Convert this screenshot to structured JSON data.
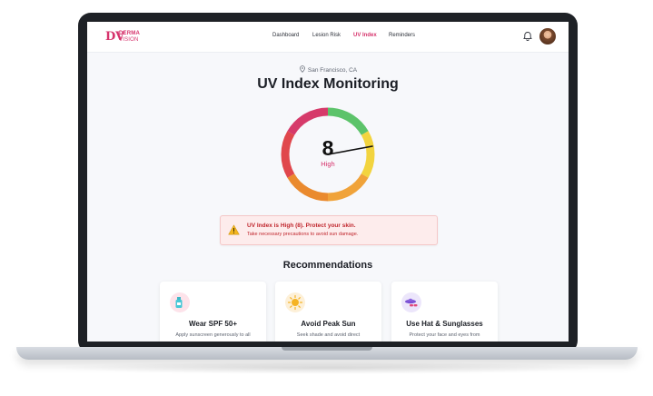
{
  "brand": {
    "line1": "DERMA",
    "line2": "VISION",
    "mark": "DV",
    "color": "#d6336c"
  },
  "nav": {
    "items": [
      {
        "label": "Dashboard",
        "active": false
      },
      {
        "label": "Lesion Risk",
        "active": false
      },
      {
        "label": "UV Index",
        "active": true
      },
      {
        "label": "Reminders",
        "active": false
      }
    ],
    "bell_icon": "bell-icon",
    "avatar": "user-avatar"
  },
  "location": {
    "icon": "map-pin-icon",
    "label": "San Francisco, CA"
  },
  "page_title": "UV Index Monitoring",
  "gauge": {
    "value": "8",
    "level": "High",
    "level_color": "#d6336c",
    "segment_colors": [
      "#5cc36a",
      "#f2d43f",
      "#f0a33a",
      "#ea8a2e",
      "#e0474c",
      "#d63a6a"
    ]
  },
  "alert": {
    "icon": "warning-icon",
    "title": "UV Index is High (8). Protect your skin.",
    "subtitle": "Take necessary precautions to avoid sun damage."
  },
  "recommendations": {
    "heading": "Recommendations",
    "cards": [
      {
        "icon": "sunscreen-bottle-icon",
        "title": "Wear SPF 50+",
        "desc": "Apply sunscreen generously to all",
        "icon_bg": "#fde3ea"
      },
      {
        "icon": "sun-icon",
        "title": "Avoid Peak Sun",
        "desc": "Seek shade and avoid direct",
        "icon_bg": "#fdf0d8"
      },
      {
        "icon": "hat-sunglasses-icon",
        "title": "Use Hat & Sunglasses",
        "desc": "Protect your face and eyes from",
        "icon_bg": "#ece6fb"
      }
    ]
  }
}
